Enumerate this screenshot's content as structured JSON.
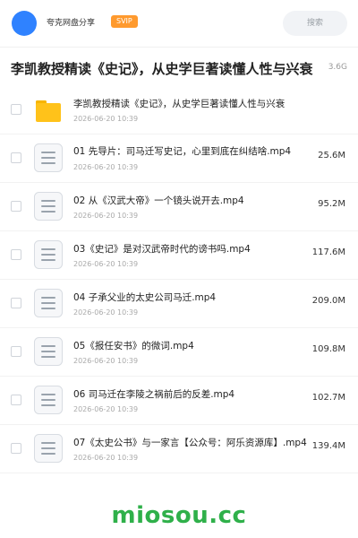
{
  "header": {
    "app_name": "夸克网盘分享",
    "badge": "SVIP",
    "search_placeholder": "搜索"
  },
  "share": {
    "title": "李凯教授精读《史记》，从史学巨著读懂人性与兴衰",
    "total_size": "3.6G"
  },
  "files": [
    {
      "type": "folder",
      "name": "李凯教授精读《史记》，从史学巨著读懂人性与兴衰",
      "date": "2026-06-20 10:39",
      "size": ""
    },
    {
      "type": "video",
      "name": "01 先导片：司马迁写史记，心里到底在纠结啥.mp4",
      "date": "2026-06-20 10:39",
      "size": "25.6M"
    },
    {
      "type": "video",
      "name": "02 从《汉武大帝》一个镜头说开去.mp4",
      "date": "2026-06-20 10:39",
      "size": "95.2M"
    },
    {
      "type": "video",
      "name": "03《史记》是对汉武帝时代的谤书吗.mp4",
      "date": "2026-06-20 10:39",
      "size": "117.6M"
    },
    {
      "type": "video",
      "name": "04 子承父业的太史公司马迁.mp4",
      "date": "2026-06-20 10:39",
      "size": "209.0M"
    },
    {
      "type": "video",
      "name": "05《报任安书》的微词.mp4",
      "date": "2026-06-20 10:39",
      "size": "109.8M"
    },
    {
      "type": "video",
      "name": "06 司马迁在李陵之祸前后的反差.mp4",
      "date": "2026-06-20 10:39",
      "size": "102.7M"
    },
    {
      "type": "video",
      "name": "07《太史公书》与一家言【公众号：阿乐资源库】.mp4",
      "date": "2026-06-20 10:39",
      "size": "139.4M"
    }
  ],
  "watermark": "miosou.cc",
  "colors": {
    "accent_blue": "#2f82ff",
    "svip_orange": "#ff9a2e",
    "folder_yellow": "#ffc21a",
    "watermark_green": "#2fb04a"
  }
}
